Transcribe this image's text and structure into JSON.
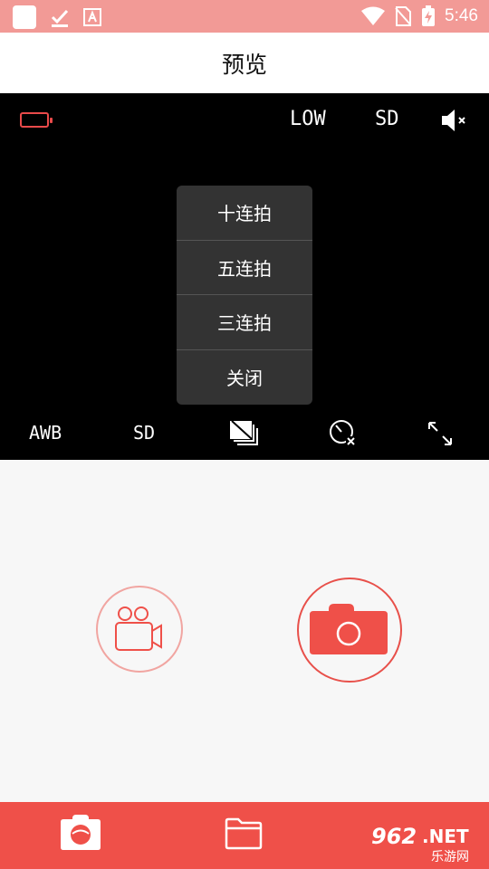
{
  "status_bar": {
    "time": "5:46"
  },
  "header": {
    "title": "预览"
  },
  "preview_top": {
    "quality": "LOW",
    "storage": "SD"
  },
  "burst_menu": {
    "items": [
      "十连拍",
      "五连拍",
      "三连拍",
      "关闭"
    ]
  },
  "preview_bottom": {
    "white_balance": "AWB",
    "resolution": "SD"
  },
  "watermark": {
    "number": "962",
    "domain": ".NET",
    "subtitle": "乐游网"
  },
  "colors": {
    "accent": "#ef5049",
    "status_bar": "#f29a96",
    "preview_bg": "#000000"
  }
}
